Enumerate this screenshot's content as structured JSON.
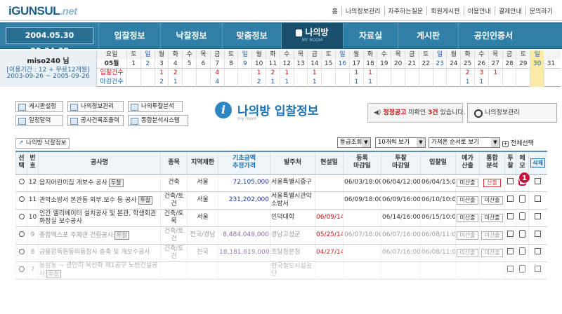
{
  "brand": {
    "logo_main": "iGUNSUL",
    "logo_net": ".net"
  },
  "top_links": [
    "홈",
    "나의정보관리",
    "자주하는질문",
    "회원게시판",
    "이용안내",
    "결제안내",
    "문의하기"
  ],
  "clock": "2004.05.30 20:34:38",
  "nav": {
    "items": [
      "입찰정보",
      "낙찰정보",
      "맞춤정보",
      "나의방",
      "자료실",
      "게시판",
      "공인인증서"
    ],
    "active_sub": "MY ROOM"
  },
  "user": {
    "name": "miso240 님",
    "period": "[이용기간 : 12 + 무료12개월]",
    "dates": "2003-09-26 ~ 2005-09-26"
  },
  "calendar": {
    "row_label_day": "요일",
    "row_label_date": "05월",
    "row_label_bid": "입찰건수",
    "row_label_close": "마감건수",
    "weekdays": [
      "토",
      "일",
      "월",
      "화",
      "수",
      "목",
      "금",
      "토",
      "일",
      "월",
      "화",
      "수",
      "목",
      "금",
      "토",
      "일",
      "월",
      "화",
      "수",
      "목",
      "금",
      "토",
      "일",
      "월",
      "화",
      "수",
      "목",
      "금",
      "토",
      "일"
    ],
    "dates": [
      "1",
      "2",
      "3",
      "4",
      "5",
      "6",
      "7",
      "8",
      "9",
      "10",
      "11",
      "12",
      "13",
      "14",
      "15",
      "16",
      "17",
      "18",
      "19",
      "20",
      "21",
      "22",
      "23",
      "24",
      "25",
      "26",
      "27",
      "28",
      "29",
      "30",
      "31"
    ],
    "bids": [
      "",
      "",
      "1",
      "2",
      "",
      "",
      "4",
      "",
      "",
      "1",
      "2",
      "1",
      "",
      "1",
      "",
      "",
      "1",
      "1",
      "",
      "",
      "",
      "",
      "",
      "",
      "2",
      "3",
      "1",
      "",
      "",
      "",
      ""
    ],
    "closes": [
      "",
      "",
      "2",
      "1",
      "",
      "",
      "4",
      "",
      "",
      "2",
      "1",
      "1",
      "",
      "1",
      "",
      "",
      "1",
      "1",
      "",
      "",
      "",
      "",
      "",
      "",
      "1",
      "1",
      "",
      "",
      "",
      "",
      ""
    ]
  },
  "toolbar": {
    "buttons": [
      "게시판설정",
      "나의정보관리",
      "나의투찰분석",
      "일정달력",
      "공사건록조출력",
      "통합분석시스템"
    ]
  },
  "title": {
    "text": "나의방 입찰정보",
    "sub": "my room"
  },
  "notice": {
    "label": "정정공고",
    "pre": "미확인",
    "count": "3건",
    "post": "있습니다."
  },
  "myinfo_btn": "나의정보관리",
  "link_btn": "나의방 낙찰정보",
  "filters": {
    "sort1": "등급조회",
    "per_page": "10개씩 보기",
    "order": "가져온 순서로 보기",
    "all_select": "전체선택"
  },
  "table": {
    "headers": [
      "선택",
      "번호",
      "공사명",
      "종목",
      "지역제한",
      "기초금액\n추정가격",
      "발주처",
      "현설일",
      "등록\n마감일",
      "투찰\n마감일",
      "입찰일",
      "예가\n산출",
      "통합\n분석",
      "투찰",
      "메모",
      "삭제"
    ],
    "rows": [
      {
        "no": "12",
        "name": "음지어린이집 개보수 공사",
        "tag": "투찰",
        "kind": "건축",
        "region": "서울",
        "price": "72,105,000",
        "client": "서울특별시중구",
        "site": "",
        "reg": "06/03/18:00",
        "bid_close": "06/04/12:00",
        "bid": "06/04/15:00",
        "calc": "미산출",
        "anal": "산출",
        "anal_red": true
      },
      {
        "no": "11",
        "name": "관악소방서 본관동 외부.보수 등 공사",
        "tag": "투찰",
        "kind": "건축/토건",
        "region": "서울",
        "price": "231,202,000",
        "client": "서울특별시관악소방서",
        "site": "",
        "reg": "06/09/18:00",
        "bid_close": "06/09/16:00",
        "bid": "06/10/10:00",
        "calc": "미산출",
        "anal": "미산출",
        "anal_red": false
      },
      {
        "no": "10",
        "name": "인간 엘리베이터 설치공사 및 본관, 학생회관 화장실 보수공사",
        "tag": "",
        "kind": "건축/토목",
        "region": "서울",
        "price": "",
        "client": "인덕대학",
        "site": "06/09/14:00",
        "reg": "",
        "bid_close": "06/14/16:00",
        "bid": "06/15/10:00",
        "calc": "미산출",
        "anal": "미산출",
        "anal_red": false
      },
      {
        "no": "9",
        "name": "종합엑스포 주제관 건립공사",
        "tag": "투찰",
        "kind": "건축/토건",
        "region": "전국/경남",
        "price": "8,484,049,000",
        "client": "경남고성군",
        "site": "05/25/14:00",
        "reg": "06/07/18:00",
        "bid_close": "06/07/16:00",
        "bid": "06/08/11:00",
        "calc": "미산출",
        "anal": "미산출",
        "anal_red": false
      },
      {
        "no": "8",
        "name": "금융감독원동의동청사 증축 및 개보수공사",
        "tag": "",
        "kind": "건축/토건",
        "region": "전국",
        "price": "18,181,819,000",
        "client": "조달청본청",
        "site": "04/27/14:00",
        "reg": "",
        "bid_close": "06/07/16:00",
        "bid": "06/08/11:00",
        "calc": "미산출",
        "anal": "미산출",
        "anal_red": false
      },
      {
        "no": "7",
        "name": "동삼동 ~ 광안리 육선화 제1공구 노반건설공사",
        "tag": "투찰",
        "kind": "",
        "region": "",
        "price": "",
        "client": "한국철도시설공단",
        "site": "",
        "reg": "",
        "bid_close": "",
        "bid": "",
        "calc": "",
        "anal": "",
        "anal_red": false
      }
    ],
    "delete_label": "삭제"
  },
  "callout": "1"
}
